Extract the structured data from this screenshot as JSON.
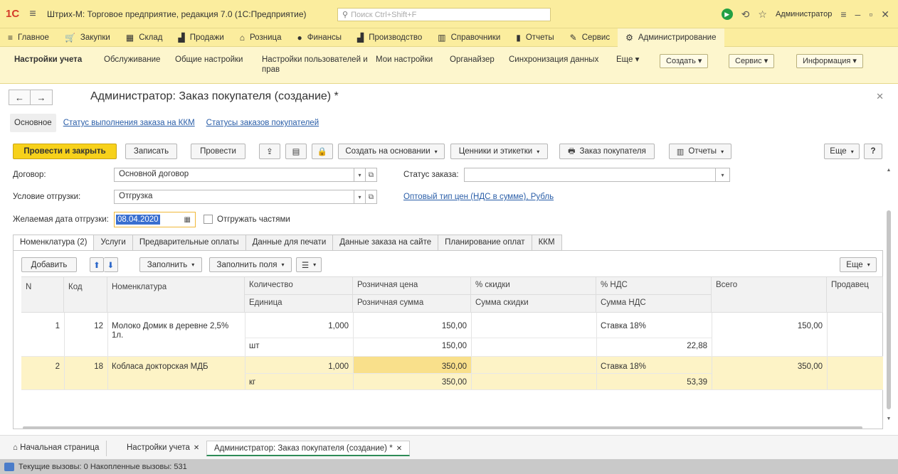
{
  "titlebar": {
    "logo": "1С",
    "title": "Штрих-М: Торговое предприятие, редакция 7.0  (1С:Предприятие)",
    "search_placeholder": "Поиск Ctrl+Shift+F",
    "user": "Администратор"
  },
  "mainmenu": [
    {
      "label": "Главное",
      "icon": "≡"
    },
    {
      "label": "Закупки",
      "icon": "🛒"
    },
    {
      "label": "Склад",
      "icon": "▦"
    },
    {
      "label": "Продажи",
      "icon": "▟"
    },
    {
      "label": "Розница",
      "icon": "⌂"
    },
    {
      "label": "Финансы",
      "icon": "●"
    },
    {
      "label": "Производство",
      "icon": "▟"
    },
    {
      "label": "Справочники",
      "icon": "▥"
    },
    {
      "label": "Отчеты",
      "icon": "▮"
    },
    {
      "label": "Сервис",
      "icon": "✎"
    },
    {
      "label": "Администрирование",
      "icon": "⚙"
    }
  ],
  "submenu": {
    "items": [
      "Настройки учета",
      "Обслуживание",
      "Общие настройки",
      "Настройки пользователей и прав",
      "Мои настройки",
      "Органайзер",
      "Синхронизация данных",
      "Еще"
    ],
    "buttons": [
      "Создать",
      "Сервис",
      "Информация"
    ]
  },
  "form": {
    "title": "Администратор: Заказ покупателя (создание) *",
    "top_tabs": [
      "Основное",
      "Статус выполнения заказа на ККМ",
      "Статусы заказов покупателей"
    ]
  },
  "toolbar": {
    "post_close": "Провести и закрыть",
    "save": "Записать",
    "post": "Провести",
    "create_based": "Создать на основании",
    "price_tags": "Ценники и этикетки",
    "order_print": "Заказ покупателя",
    "reports": "Отчеты",
    "more": "Еще",
    "help": "?"
  },
  "fields": {
    "contract_label": "Договор:",
    "contract_value": "Основной договор",
    "status_label": "Статус заказа:",
    "status_value": "",
    "shipment_label": "Условие отгрузки:",
    "shipment_value": "Отгрузка",
    "price_link": "Оптовый тип цен (НДС в сумме), Рубль",
    "date_label": "Желаемая дата отгрузки:",
    "date_value": "08.04.2020",
    "partial_label": "Отгружать частями"
  },
  "inner_tabs": [
    "Номенклатура (2)",
    "Услуги",
    "Предварительные оплаты",
    "Данные для печати",
    "Данные заказа на сайте",
    "Планирование оплат",
    "ККМ"
  ],
  "table_toolbar": {
    "add": "Добавить",
    "fill": "Заполнить",
    "fill_fields": "Заполнить поля",
    "more": "Еще"
  },
  "table": {
    "headers": {
      "n": "N",
      "code": "Код",
      "nom": "Номенклатура",
      "qty": "Количество",
      "unit": "Единица",
      "price": "Розничная цена",
      "sum": "Розничная сумма",
      "disc": "% скидки",
      "disc_sum": "Сумма скидки",
      "vat": "% НДС",
      "vat_sum": "Сумма НДС",
      "total": "Всего",
      "seller": "Продавец"
    },
    "rows": [
      {
        "n": "1",
        "code": "12",
        "nom": "Молоко Домик в деревне 2,5% 1л.",
        "qty": "1,000",
        "unit": "шт",
        "price": "150,00",
        "sum": "150,00",
        "vat": "Ставка 18%",
        "vat_sum": "22,88",
        "total": "150,00"
      },
      {
        "n": "2",
        "code": "18",
        "nom": "Кобласа докторская МДБ",
        "qty": "1,000",
        "unit": "кг",
        "price": "350,00",
        "sum": "350,00",
        "vat": "Ставка 18%",
        "vat_sum": "53,39",
        "total": "350,00"
      }
    ]
  },
  "bottom_tabs": [
    "Начальная страница",
    "Настройки учета",
    "Администратор: Заказ покупателя (создание) *"
  ],
  "status": "Текущие вызовы: 0   Накопленные вызовы: 531"
}
